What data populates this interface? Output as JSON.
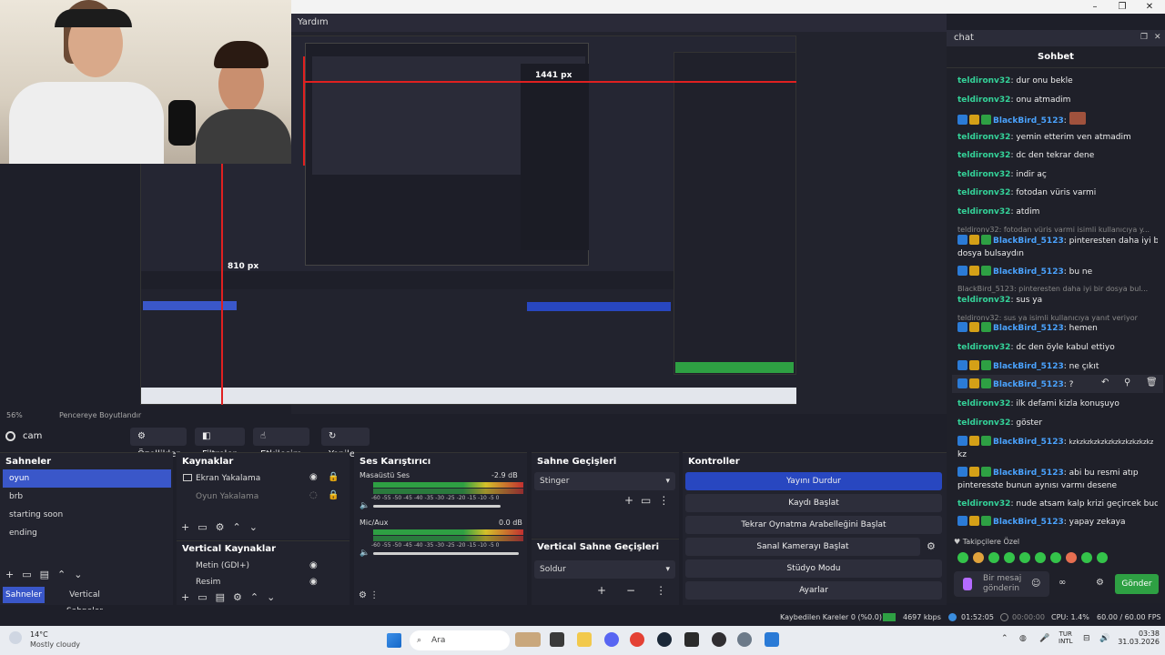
{
  "window": {
    "controls": [
      "–",
      "❐",
      "✕"
    ]
  },
  "projector": {
    "title": "Yardım"
  },
  "nested_labels": {
    "px1": "1441 px",
    "px2": "810 px",
    "zoom": "56%",
    "resize": "Pencereye Boyutlandır"
  },
  "chat": {
    "header": "chat",
    "title": "Sohbet",
    "messages": [
      {
        "user": "teldironv32",
        "text": "dur onu bekle",
        "style": "u"
      },
      {
        "user": "teldironv32",
        "text": "onu atmadim",
        "style": "u"
      },
      {
        "user": "BlackBird_5123",
        "text": "",
        "style": "u2",
        "badges": true
      },
      {
        "user": "teldironv32",
        "text": "yemin etterim ven atmadim",
        "style": "u"
      },
      {
        "user": "teldironv32",
        "text": "dc den tekrar dene",
        "style": "u"
      },
      {
        "user": "teldironv32",
        "text": "indir aç",
        "style": "u"
      },
      {
        "user": "teldironv32",
        "text": "fotodan vüris varmi",
        "style": "u"
      },
      {
        "user": "teldironv32",
        "text": "atdim",
        "style": "u"
      }
    ],
    "reply1": "teldironv32: fotodan vüris varmi isimli kullanıcıya y...",
    "msg_pinter_user": "BlackBird_5123",
    "msg_pinter_text": "pinteresten daha iyi bir",
    "msg_pinter_text2": "dosya bulsaydın",
    "msg_buneuser": "BlackBird_5123",
    "msg_bune": "bu ne",
    "reply2": "BlackBird_5123: pinteresten daha iyi bir dosya bul...",
    "msg_susya_user": "teldironv32",
    "msg_susya": "sus ya",
    "reply3": "teldironv32: sus ya isimli kullanıcıya yanıt veriyor",
    "msg_hemen_user": "BlackBird_5123",
    "msg_hemen": "hemen",
    "msg_dcden_user": "teldironv32",
    "msg_dcden": "dc den öyle kabul ettiyo",
    "msg_cikit_user": "BlackBird_5123",
    "msg_cikit": "ne çıkıt",
    "msg_q_user": "BlackBird_5123",
    "msg_q": "?",
    "msg_ilk_user": "teldironv32",
    "msg_ilk": "ilk defami kizla konuşuyo",
    "msg_goster_user": "teldironv32",
    "msg_goster": "göster",
    "msg_kz_user": "BlackBird_5123",
    "msg_kz": "kzkzkzkzkzkzkzkzkzkzkzkz",
    "msg_kz2": "kz",
    "msg_abi_user": "BlackBird_5123",
    "msg_abi": "abi bu resmi atıp",
    "msg_abi2": "pinteresste bunun aynısı varmı desene",
    "msg_nude_user": "teldironv32",
    "msg_nude": "nude atsam kalp krizi geçircek buda",
    "msg_zekaya_user": "BlackBird_5123",
    "msg_zekaya": "yapay zekaya",
    "followers": "Takipçilere Özel",
    "input_placeholder": "Bir mesaj gönderin",
    "send": "Gönder"
  },
  "toolbar": {
    "source": "cam",
    "props": "Özellikler",
    "filters": "Filtreler",
    "interact": "Etkileşim",
    "refresh": "Yenile"
  },
  "scenes": {
    "title": "Sahneler",
    "items": [
      "oyun",
      "brb",
      "starting soon",
      "ending"
    ],
    "tab1": "Sahneler",
    "tab2": "Vertical Sahneler"
  },
  "sources": {
    "title": "Kaynaklar",
    "items": [
      "Ekran Yakalama",
      "Oyun Yakalama"
    ]
  },
  "vsources": {
    "title": "Vertical Kaynaklar",
    "items": [
      "Metin (GDI+)",
      "Resim"
    ]
  },
  "mixer": {
    "title": "Ses Karıştırıcı",
    "ch1": "Masaüstü Ses",
    "ch1_db": "-2.9 dB",
    "ch2": "Mic/Aux",
    "ch2_db": "0.0 dB",
    "scale": "-60 -55 -50 -45 -40 -35 -30 -25 -20 -15 -10 -5 0"
  },
  "transitions": {
    "title": "Sahne Geçişleri",
    "value": "Stinger"
  },
  "vtransitions": {
    "title": "Vertical Sahne Geçişleri",
    "value": "Soldur"
  },
  "controls": {
    "title": "Kontroller",
    "items": [
      "Yayını Durdur",
      "Kaydı Başlat",
      "Tekrar Oynatma Arabelleğini Başlat",
      "Sanal Kamerayı Başlat",
      "Stüdyo Modu",
      "Ayarlar"
    ]
  },
  "status": {
    "dropped": "Kaybedilen Kareler 0 (%0.0)",
    "kbps": "4697 kbps",
    "live": "01:52:05",
    "rec": "00:00:00",
    "cpu": "CPU: 1.4%",
    "fps": "60.00 / 60.00 FPS"
  },
  "taskbar": {
    "temp": "14°C",
    "weather": "Mostly cloudy",
    "search": "Ara",
    "lang1": "TUR",
    "lang2": "INTL",
    "time": "03:38",
    "date": "31.03.2026"
  }
}
